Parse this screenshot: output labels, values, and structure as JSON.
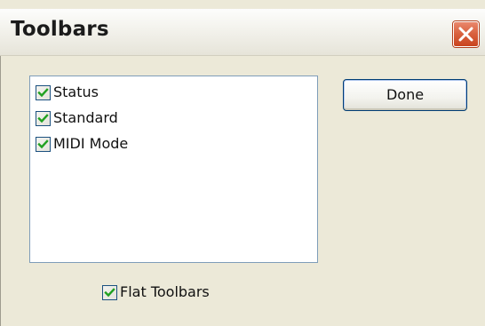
{
  "window": {
    "title": "Toolbars",
    "close_icon": "close-x-icon",
    "accent": "#d8603d"
  },
  "toolbar_list": {
    "items": [
      {
        "label": "Status",
        "checked": true
      },
      {
        "label": "Standard",
        "checked": true
      },
      {
        "label": "MIDI Mode",
        "checked": true
      }
    ]
  },
  "buttons": {
    "done_label": "Done"
  },
  "options": {
    "flat_toolbars_label": "Flat Toolbars",
    "flat_toolbars_checked": true
  },
  "colors": {
    "dialog_bg": "#ece9d8",
    "checkmark": "#21a121",
    "list_border": "#7f9db9"
  }
}
